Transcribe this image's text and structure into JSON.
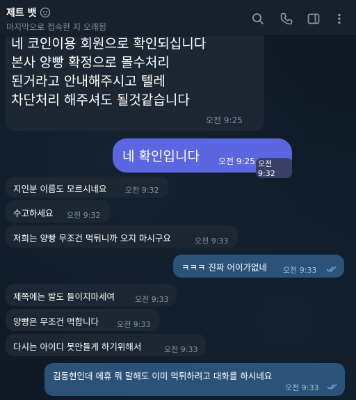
{
  "header": {
    "title": "제트 뱃",
    "status": "마지막으로 접속한 지 오래됨"
  },
  "messages": {
    "m0": {
      "text": "네 코인이용 회원으로 확인되십니다\n본사 양빵 확정으로 몰수처리\n된거라고 안내해주시고 텔레\n차단처리 해주셔도 될것같습니다",
      "time": "오전 9:25"
    },
    "m1": {
      "text": "네 확인입니다",
      "time": "오전 9:25",
      "time_overlay": "오전 9:32"
    },
    "m2": {
      "text": "지인분 이름도 모르시네요",
      "time": "오전 9:32"
    },
    "m3": {
      "text": "수고하세요",
      "time": "오전 9:32"
    },
    "m4": {
      "text": "저희는 양빵 무조건 먹튀니까 오지 마시구요",
      "time": "오전 9:33"
    },
    "m5": {
      "text": "ㅋㅋㅋ 진짜 어이가없네",
      "time": "오전 9:33"
    },
    "m6": {
      "text": "제쪽에는 발도 들이지마세여",
      "time": "오전 9:33"
    },
    "m7": {
      "text": "양빵은 무조건 먹합니다",
      "time": "오전 9:33"
    },
    "m8": {
      "text": "다시는 아이디 못만들게 하기위해서",
      "time": "오전 9:33"
    },
    "m9": {
      "text": "김동현인데 에휴 뭐 말해도 이미 먹튀하려고 대화를 하시네요",
      "time": "오전 9:33"
    }
  },
  "colors": {
    "header_bg": "#17212b",
    "incoming_bubble": "#1d2733",
    "outgoing_bubble": "#2b5278",
    "highlight_bubble": "#5b66e0",
    "read_check": "#6ab2f2"
  },
  "icons": [
    "search-icon",
    "phone-icon",
    "sidebar-toggle-icon",
    "more-menu-icon",
    "emoji-badge-icon"
  ]
}
